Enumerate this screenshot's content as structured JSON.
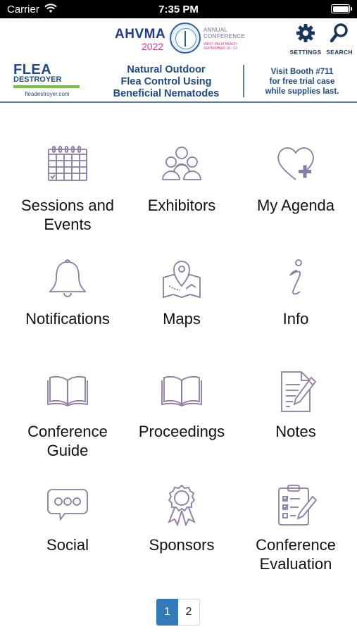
{
  "status_bar": {
    "carrier": "Carrier",
    "time": "7:35 PM"
  },
  "header": {
    "logo": {
      "name": "AHVMA",
      "year": "2022",
      "annual": "ANNUAL",
      "conference": "CONFERENCE",
      "city": "WEST PALM BEACH",
      "dates": "SEPTEMBER 10 - 13"
    },
    "settings_label": "SETTINGS",
    "search_label": "SEARCH"
  },
  "banner": {
    "brand_line1": "FLEA",
    "brand_line2": "DESTROYER",
    "brand_url": "fleadestroyer.com",
    "tagline": [
      "Natural Outdoor",
      "Flea Control Using",
      "Beneficial Nematodes"
    ],
    "booth": [
      "Visit Booth #711",
      "for free trial case",
      "while supplies last."
    ]
  },
  "tiles": [
    {
      "label": [
        "Sessions and",
        "Events"
      ],
      "icon": "calendar-icon"
    },
    {
      "label": [
        "Exhibitors"
      ],
      "icon": "people-group-icon"
    },
    {
      "label": [
        "My Agenda"
      ],
      "icon": "heart-plus-icon"
    },
    {
      "label": [
        "Notifications"
      ],
      "icon": "bell-icon"
    },
    {
      "label": [
        "Maps"
      ],
      "icon": "map-pin-icon"
    },
    {
      "label": [
        "Info"
      ],
      "icon": "info-icon"
    },
    {
      "label": [
        "Conference",
        "Guide"
      ],
      "icon": "open-book-icon"
    },
    {
      "label": [
        "Proceedings"
      ],
      "icon": "open-book-icon"
    },
    {
      "label": [
        "Notes"
      ],
      "icon": "notepad-pen-icon"
    },
    {
      "label": [
        "Social"
      ],
      "icon": "chat-bubble-icon"
    },
    {
      "label": [
        "Sponsors"
      ],
      "icon": "ribbon-award-icon"
    },
    {
      "label": [
        "Conference",
        "Evaluation"
      ],
      "icon": "clipboard-checklist-icon"
    }
  ],
  "pagination": {
    "pages": [
      "1",
      "2"
    ],
    "current": "1"
  },
  "colors": {
    "icon_stroke": "#8a7aa6",
    "brand_blue": "#1e4a8b",
    "active_page": "#337ab7"
  }
}
